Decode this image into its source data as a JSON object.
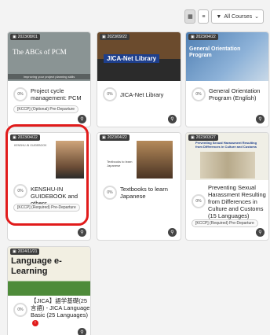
{
  "toolbar": {
    "grid_icon": "grid-icon",
    "list_icon": "list-icon",
    "filter_label": "All Courses",
    "filter_icon": "filter-icon"
  },
  "cards": [
    {
      "date": "2023/08/01",
      "title": "Project cycle management: PCM",
      "progress": "0%",
      "tag": "[KCCP] (Optional) Pre-Departure",
      "thumb_title": "The ABCs of PCM",
      "thumb_sub": "Improving your project planning skills"
    },
    {
      "date": "2023/09/22",
      "title": "JICA-Net Library",
      "progress": "0%",
      "thumb_title": "JICA-Net Library"
    },
    {
      "date": "2023/04/22",
      "title": "General Orientation Program (English)",
      "progress": "0%",
      "thumb_title": "General Orientation Program"
    },
    {
      "date": "2023/04/22",
      "title": "KENSHU-IN GUIDEBOOK and others",
      "progress": "0%",
      "tag": "[KCCP] (Required) Pre-Departure",
      "thumb_title": "KENSHU-IN GUIDEBOOK"
    },
    {
      "date": "2023/04/22",
      "title": "Textbooks to learn Japanese",
      "progress": "0%",
      "thumb_title": "Textbooks to learn Japanese"
    },
    {
      "date": "2023/03/27",
      "title": "Preventing Sexual Harassment Resulting from Differences in Culture and Customs (15 Languages)",
      "progress": "0%",
      "tag": "[KCCP] (Required) Pre-Departure",
      "thumb_title": "Preventing Sexual Harassment Resulting from Differences in Culture and Customs"
    },
    {
      "date": "2024/11/21",
      "title": "【JICA】語学基礎(25言語) - JICA Language Basic (25 Languages)",
      "progress": "0%",
      "alert": "!",
      "thumb_title": "Language e-Learning"
    }
  ],
  "colors": {
    "highlight": "#e11b1b",
    "jica_blue": "#1e3f8c"
  }
}
